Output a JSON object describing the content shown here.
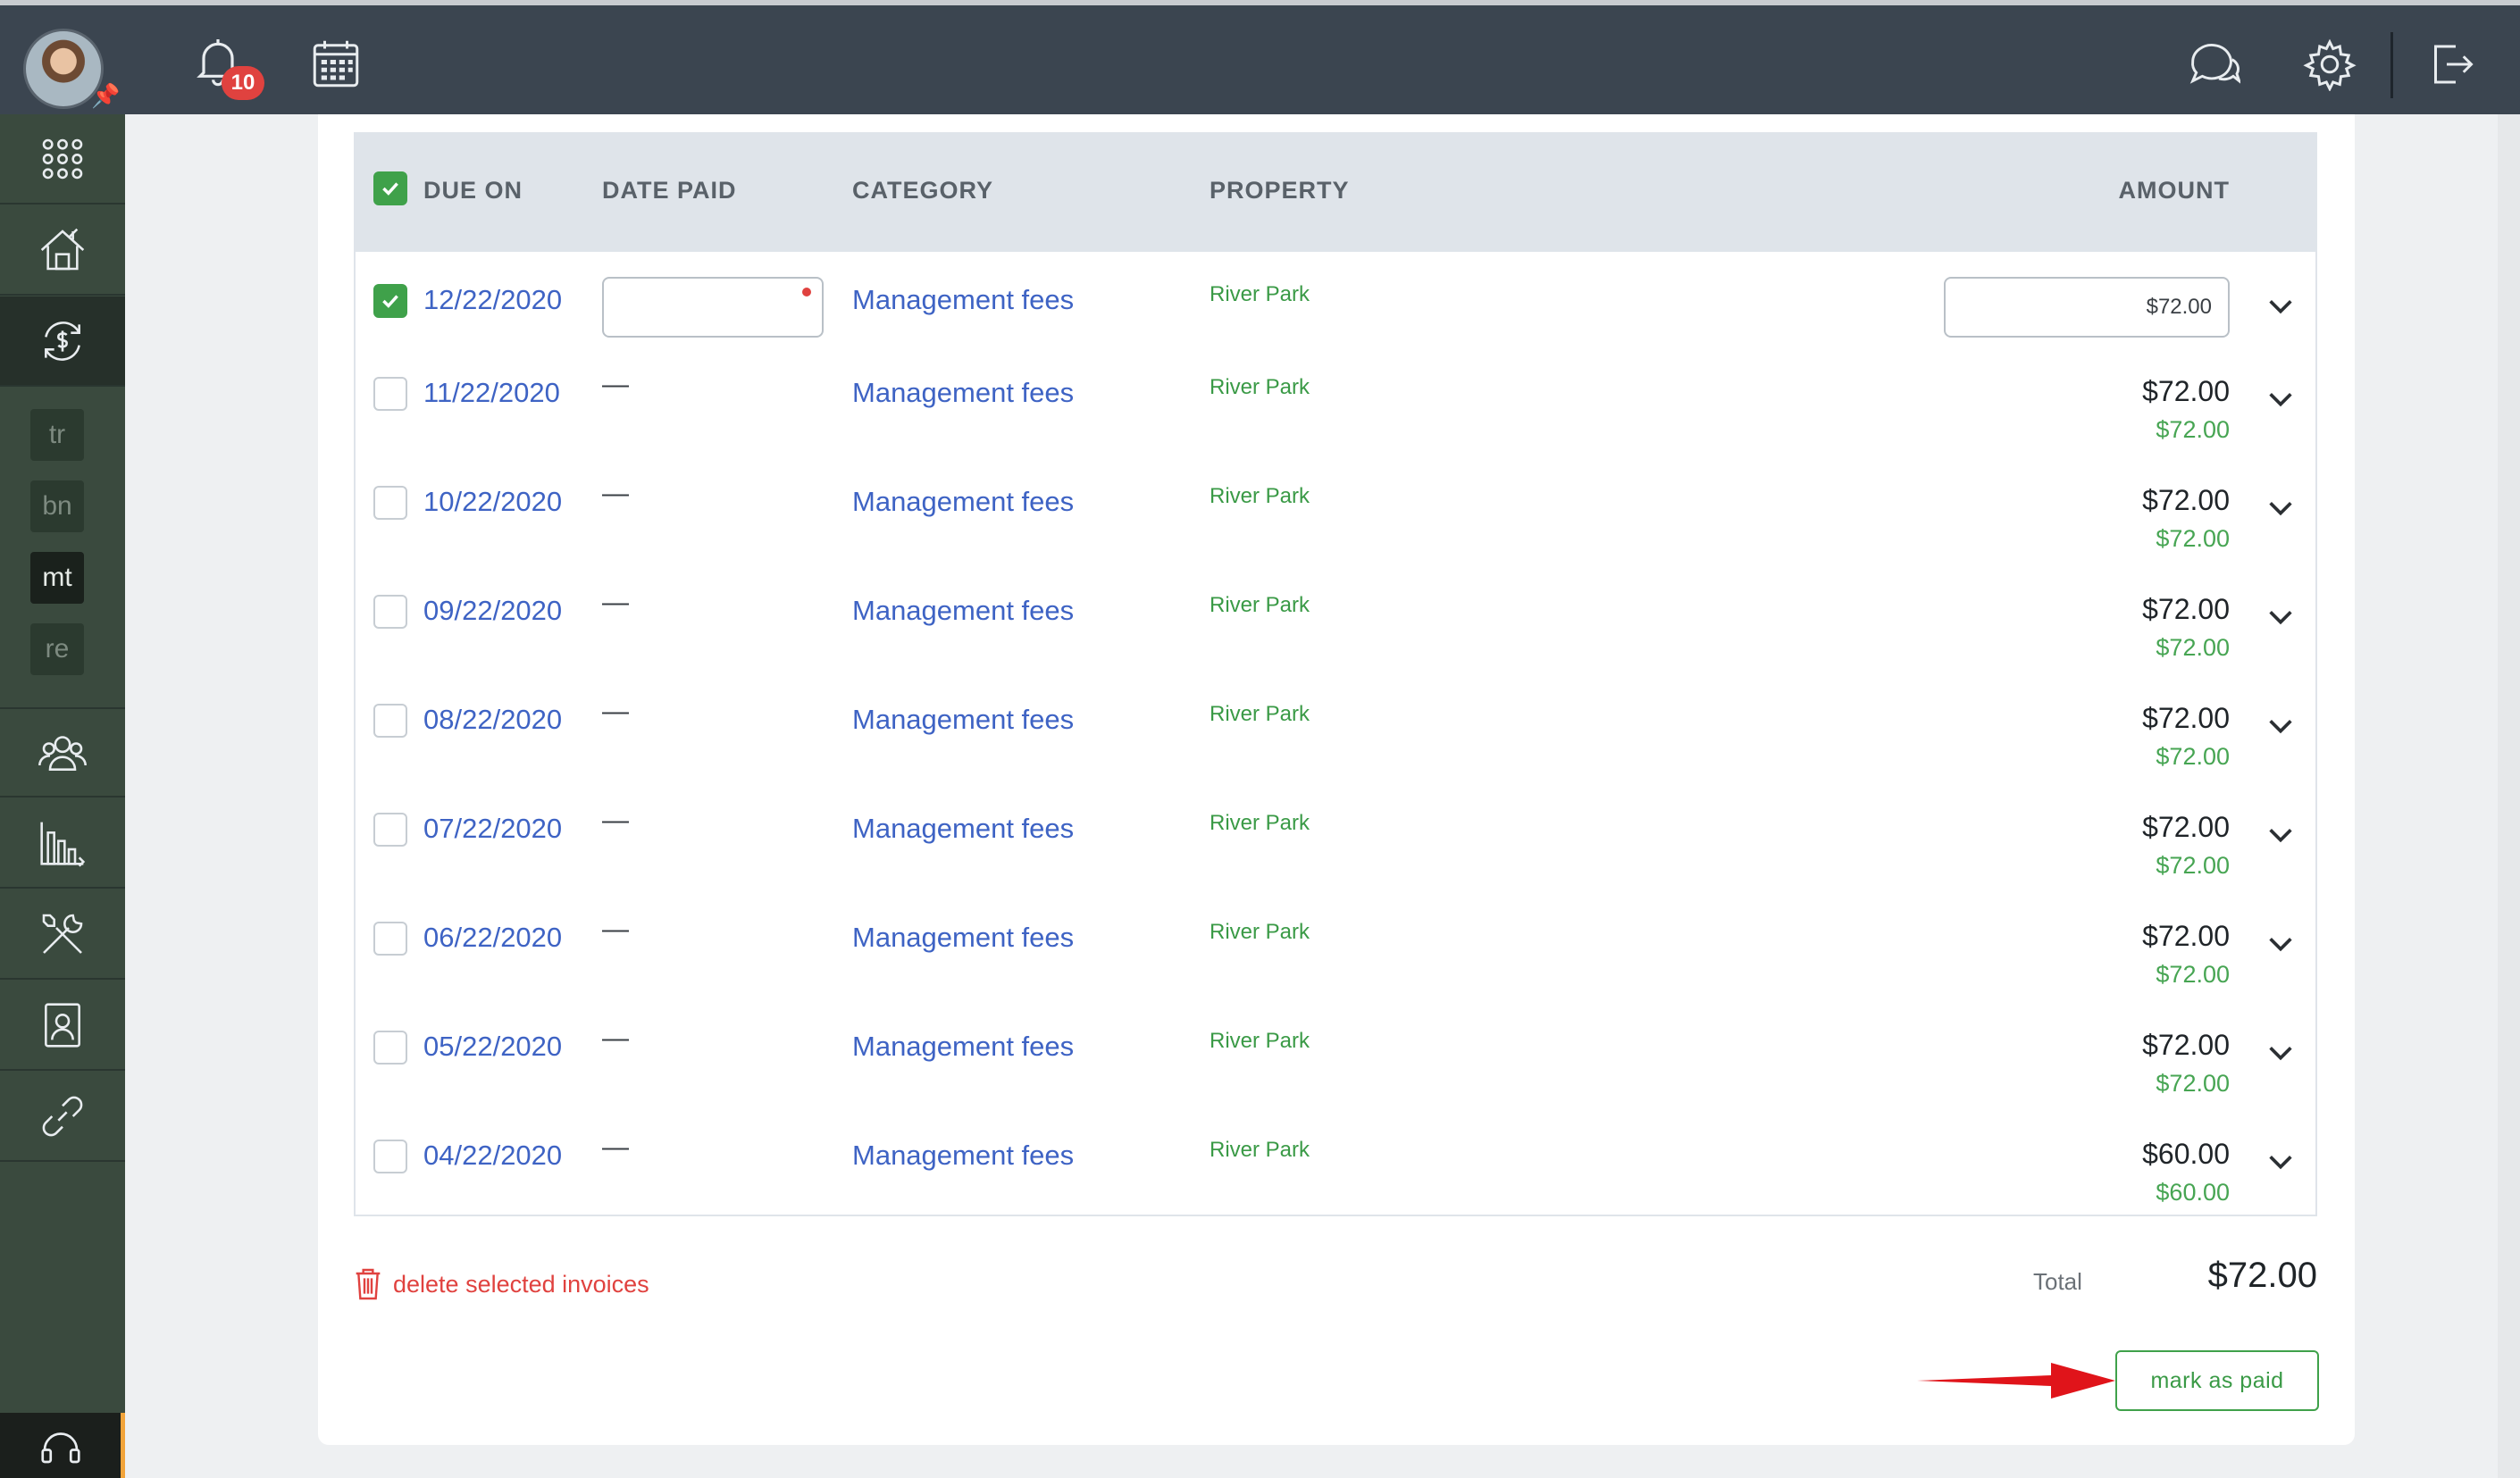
{
  "topbar": {
    "notification_count": "10"
  },
  "sidebar": {
    "sub_items": [
      "tr",
      "bn",
      "mt",
      "re"
    ],
    "active_sub": "mt"
  },
  "table": {
    "headers": {
      "due_on": "DUE ON",
      "date_paid": "DATE PAID",
      "category": "CATEGORY",
      "property": "PROPERTY",
      "amount": "AMOUNT"
    },
    "rows": [
      {
        "due": "12/22/2020",
        "paid": "",
        "category": "Management fees",
        "property": "River Park",
        "amount": "$72.00",
        "amount_paid": "",
        "checked": true,
        "editing": true
      },
      {
        "due": "11/22/2020",
        "paid": "—",
        "category": "Management fees",
        "property": "River Park",
        "amount": "$72.00",
        "amount_paid": "$72.00",
        "checked": false,
        "editing": false
      },
      {
        "due": "10/22/2020",
        "paid": "—",
        "category": "Management fees",
        "property": "River Park",
        "amount": "$72.00",
        "amount_paid": "$72.00",
        "checked": false,
        "editing": false
      },
      {
        "due": "09/22/2020",
        "paid": "—",
        "category": "Management fees",
        "property": "River Park",
        "amount": "$72.00",
        "amount_paid": "$72.00",
        "checked": false,
        "editing": false
      },
      {
        "due": "08/22/2020",
        "paid": "—",
        "category": "Management fees",
        "property": "River Park",
        "amount": "$72.00",
        "amount_paid": "$72.00",
        "checked": false,
        "editing": false
      },
      {
        "due": "07/22/2020",
        "paid": "—",
        "category": "Management fees",
        "property": "River Park",
        "amount": "$72.00",
        "amount_paid": "$72.00",
        "checked": false,
        "editing": false
      },
      {
        "due": "06/22/2020",
        "paid": "—",
        "category": "Management fees",
        "property": "River Park",
        "amount": "$72.00",
        "amount_paid": "$72.00",
        "checked": false,
        "editing": false
      },
      {
        "due": "05/22/2020",
        "paid": "—",
        "category": "Management fees",
        "property": "River Park",
        "amount": "$72.00",
        "amount_paid": "$72.00",
        "checked": false,
        "editing": false
      },
      {
        "due": "04/22/2020",
        "paid": "—",
        "category": "Management fees",
        "property": "River Park",
        "amount": "$60.00",
        "amount_paid": "$60.00",
        "checked": false,
        "editing": false
      }
    ]
  },
  "footer": {
    "delete_label": "delete selected invoices",
    "total_label": "Total",
    "total_value": "$72.00",
    "mark_paid_label": "mark as paid"
  },
  "colors": {
    "topbar": "#3b4550",
    "sidebar": "#3a4a3e",
    "link_blue": "#3e63c4",
    "green": "#3fa14a",
    "red": "#e0423f"
  }
}
